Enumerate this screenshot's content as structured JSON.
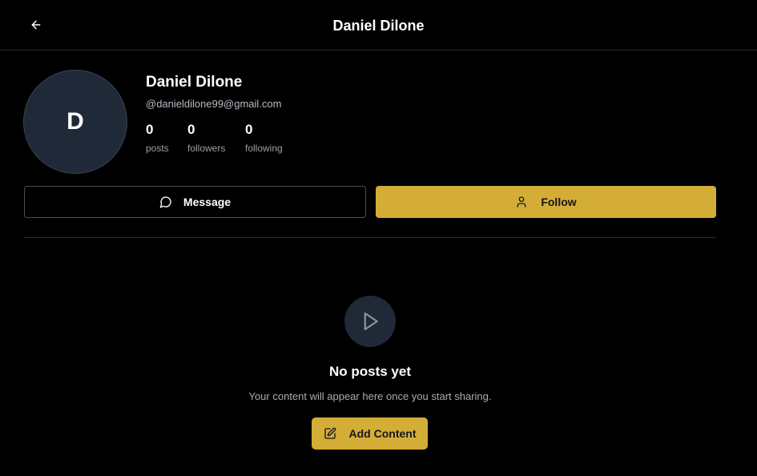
{
  "header": {
    "back_icon": "arrow-left-icon",
    "title": "Daniel Dilone"
  },
  "profile": {
    "avatar_initial": "D",
    "name": "Daniel Dilone",
    "handle": "@danieldilone99@gmail.com",
    "stats": [
      {
        "value": "0",
        "label": "posts"
      },
      {
        "value": "0",
        "label": "followers"
      },
      {
        "value": "0",
        "label": "following"
      }
    ]
  },
  "actions": {
    "message_label": "Message",
    "message_icon": "message-circle-icon",
    "follow_label": "Follow",
    "follow_icon": "user-icon"
  },
  "empty_state": {
    "icon": "play-icon",
    "title": "No posts yet",
    "subtitle": "Your content will appear here once you start sharing.",
    "add_label": "Add Content",
    "add_icon": "edit-icon"
  },
  "colors": {
    "background": "#000000",
    "accent": "#d4ad37",
    "surface": "#1f2937"
  }
}
